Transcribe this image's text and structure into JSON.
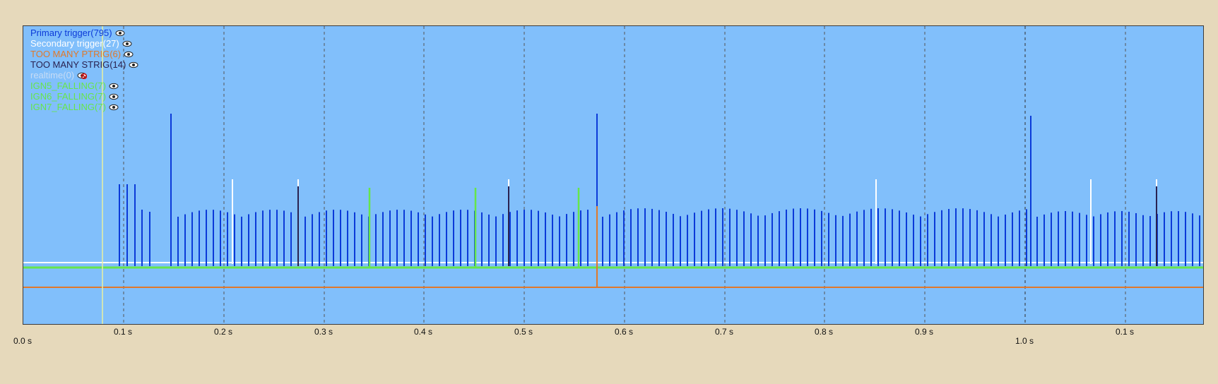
{
  "legend": [
    {
      "label": "Primary trigger(795)",
      "color": "#0b3ad8",
      "icon": "eye-icon",
      "hidden": false
    },
    {
      "label": "Secondary trigger(27)",
      "color": "#ffffff",
      "icon": "eye-icon",
      "hidden": false
    },
    {
      "label": "TOO MANY PTRIG(6)",
      "color": "#e0782a",
      "icon": "eye-icon",
      "hidden": false
    },
    {
      "label": "TOO MANY STRIG(14)",
      "color": "#2a2250",
      "icon": "eye-icon",
      "hidden": false
    },
    {
      "label": "realtime(0)",
      "color": "#c7dcf5",
      "icon": "eye-hidden-icon",
      "hidden": true
    },
    {
      "label": "IGN5_FALLING(7)",
      "color": "#66e64a",
      "icon": "eye-icon",
      "hidden": false
    },
    {
      "label": "IGN6_FALLING(7)",
      "color": "#66e64a",
      "icon": "eye-icon",
      "hidden": false
    },
    {
      "label": "IGN7_FALLING(7)",
      "color": "#66e64a",
      "icon": "eye-icon",
      "hidden": false
    }
  ],
  "axis": {
    "ticks": [
      "0.1 s",
      "0.2 s",
      "0.3 s",
      "0.4 s",
      "0.5 s",
      "0.6 s",
      "0.7 s",
      "0.8 s",
      "0.9 s",
      "0.1 s"
    ],
    "start_label": "0.0 s",
    "major_label": "1.0 s"
  },
  "colors": {
    "background": "#e6d9bb",
    "plot": "#81bffb",
    "primary": "#0b3ad8",
    "secondary": "#ffffff",
    "too_many_ptrig": "#e0782a",
    "too_many_strig": "#2a2250",
    "ign": "#66e64a",
    "cursor": "#e8f0a0"
  }
}
